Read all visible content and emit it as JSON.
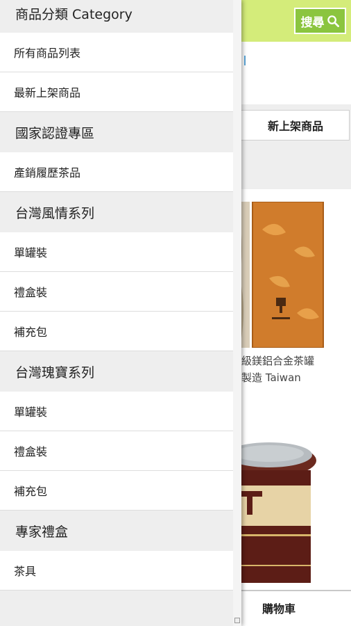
{
  "header": {
    "search_label": "搜尋"
  },
  "content": {
    "new_items_tab": "新上架商品",
    "product1_caption_line1": "級鎂鋁合金茶罐",
    "product1_caption_line2": "製造 Taiwan",
    "cart_label": "購物車"
  },
  "drawer": {
    "sections": [
      {
        "title": "商品分類 Category",
        "items": [
          "所有商品列表",
          "最新上架商品"
        ]
      },
      {
        "title": "國家認證專區",
        "items": [
          "產銷履歷茶品"
        ]
      },
      {
        "title": "台灣風情系列",
        "items": [
          "單罐裝",
          "禮盒裝",
          "補充包"
        ]
      },
      {
        "title": "台灣瑰寶系列",
        "items": [
          "單罐裝",
          "禮盒裝",
          "補充包"
        ]
      },
      {
        "title": "專家禮盒",
        "items": [
          "茶具"
        ]
      }
    ]
  },
  "colors": {
    "header_bg": "#d4ec7a",
    "search_button": "#8bc53f",
    "section_bg": "#eeeeee"
  }
}
